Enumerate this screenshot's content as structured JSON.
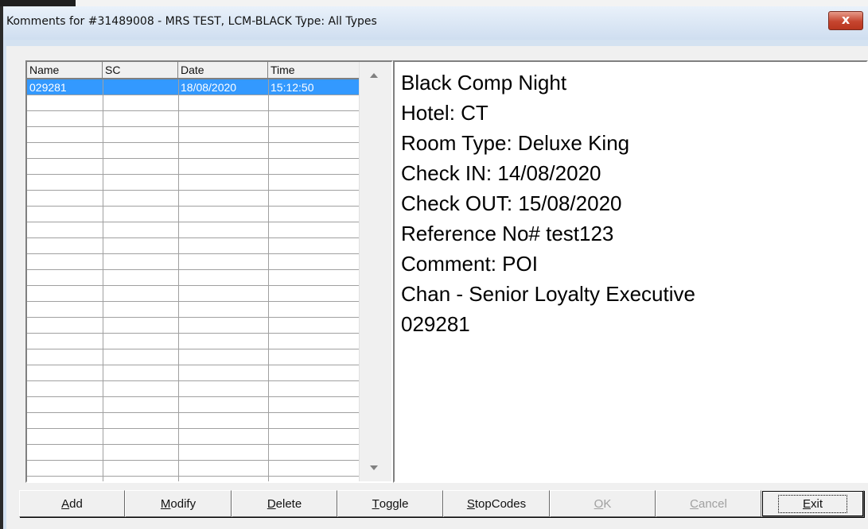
{
  "window": {
    "title": "Komments for #31489008 - MRS TEST, LCM-BLACK   Type: All Types",
    "close_label": "x"
  },
  "list": {
    "headers": [
      "Name",
      "SC",
      "Date",
      "Time"
    ],
    "rows": [
      {
        "name": "029281",
        "sc": "",
        "date": "18/08/2020",
        "time": "15:12:50",
        "selected": true
      }
    ]
  },
  "comment": {
    "lines": [
      "Black Comp Night",
      "Hotel: CT",
      "Room Type: Deluxe King",
      "Check IN: 14/08/2020",
      "Check OUT: 15/08/2020",
      "Reference No# test123",
      "Comment: POI",
      "Chan - Senior Loyalty Executive",
      "029281"
    ]
  },
  "buttons": {
    "add": {
      "mn": "A",
      "rest": "dd"
    },
    "modify": {
      "mn": "M",
      "rest": "odify"
    },
    "delete": {
      "mn": "D",
      "rest": "elete"
    },
    "toggle": {
      "mn": "T",
      "rest": "oggle"
    },
    "stopcodes": {
      "mn": "S",
      "rest": "topCodes"
    },
    "ok": {
      "mn": "O",
      "rest": "K"
    },
    "cancel": {
      "mn": "C",
      "rest": "ancel"
    },
    "exit": {
      "mn": "E",
      "rest": "xit"
    }
  },
  "colors": {
    "selection": "#3399ff",
    "close": "#c6452f"
  }
}
